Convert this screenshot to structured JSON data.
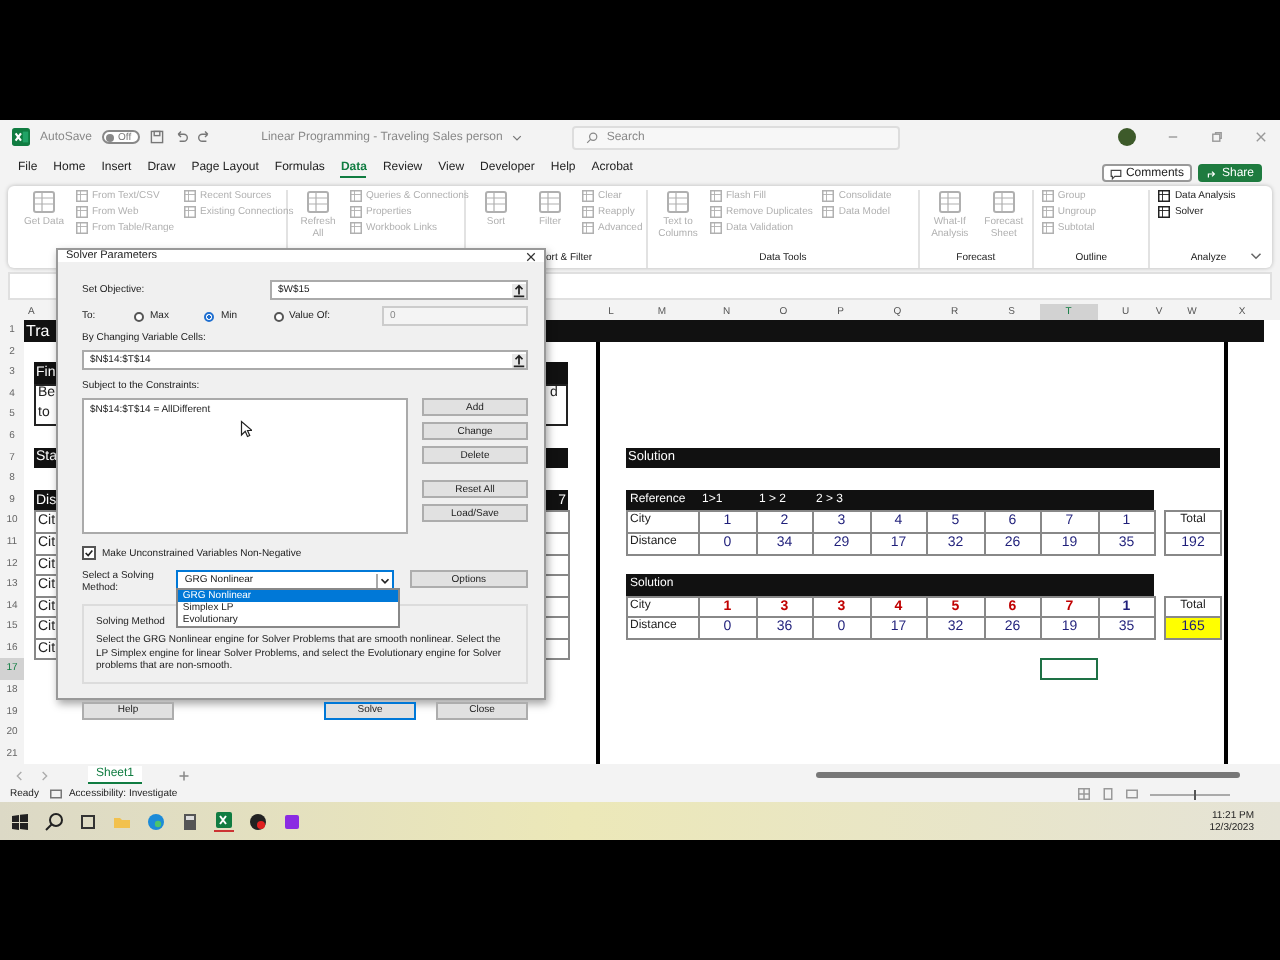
{
  "title_bar": {
    "autosave_label": "AutoSave",
    "autosave_state": "Off",
    "autosave_on": false,
    "document_title": "Linear Programming - Traveling Sales person",
    "search_placeholder": "Search"
  },
  "menu_tabs": [
    {
      "label": "File",
      "selected": false
    },
    {
      "label": "Home",
      "selected": false
    },
    {
      "label": "Insert",
      "selected": false
    },
    {
      "label": "Draw",
      "selected": false
    },
    {
      "label": "Page Layout",
      "selected": false
    },
    {
      "label": "Formulas",
      "selected": false
    },
    {
      "label": "Data",
      "selected": true
    },
    {
      "label": "Review",
      "selected": false
    },
    {
      "label": "View",
      "selected": false
    },
    {
      "label": "Developer",
      "selected": false
    },
    {
      "label": "Help",
      "selected": false
    },
    {
      "label": "Acrobat",
      "selected": false
    }
  ],
  "comments_button": "Comments",
  "share_button": "Share",
  "ribbon": [
    {
      "columns": [
        {
          "kind": "large",
          "items": [
            {
              "label": "Get Data",
              "disabled": true
            }
          ]
        },
        {
          "kind": "small",
          "items": [
            {
              "label": "From Text/CSV",
              "disabled": true
            },
            {
              "label": "From Web",
              "disabled": true
            },
            {
              "label": "From Table/Range",
              "disabled": true
            }
          ]
        },
        {
          "kind": "small",
          "items": [
            {
              "label": "Recent Sources",
              "disabled": true
            },
            {
              "label": "Existing Connections",
              "disabled": true
            }
          ]
        }
      ]
    },
    {
      "columns": [
        {
          "kind": "large",
          "items": [
            {
              "label": "Refresh All",
              "disabled": true
            }
          ]
        },
        {
          "kind": "small",
          "items": [
            {
              "label": "Queries & Connections",
              "disabled": true
            },
            {
              "label": "Properties",
              "disabled": true
            },
            {
              "label": "Workbook Links",
              "disabled": true
            }
          ]
        }
      ]
    },
    {
      "label": "ort & Filter",
      "columns": [
        {
          "kind": "large",
          "items": [
            {
              "label": "Sort",
              "disabled": true
            }
          ]
        },
        {
          "kind": "large",
          "items": [
            {
              "label": "Filter",
              "disabled": true
            }
          ]
        },
        {
          "kind": "small",
          "items": [
            {
              "label": "Clear",
              "disabled": true
            },
            {
              "label": "Reapply",
              "disabled": true
            },
            {
              "label": "Advanced",
              "disabled": true
            }
          ]
        }
      ]
    },
    {
      "label": "Data Tools",
      "columns": [
        {
          "kind": "large",
          "items": [
            {
              "label": "Text to Columns",
              "disabled": true
            }
          ]
        },
        {
          "kind": "small",
          "items": [
            {
              "label": "Flash Fill",
              "disabled": true
            },
            {
              "label": "Remove Duplicates",
              "disabled": true
            },
            {
              "label": "Data Validation",
              "disabled": true
            }
          ]
        },
        {
          "kind": "small",
          "items": [
            {
              "label": "Consolidate",
              "disabled": true
            },
            {
              "label": "Data Model",
              "disabled": true
            }
          ]
        }
      ]
    },
    {
      "label": "Forecast",
      "columns": [
        {
          "kind": "large",
          "items": [
            {
              "label": "What-If Analysis",
              "disabled": true
            }
          ]
        },
        {
          "kind": "large",
          "items": [
            {
              "label": "Forecast Sheet",
              "disabled": true
            }
          ]
        }
      ]
    },
    {
      "label": "Outline",
      "columns": [
        {
          "kind": "small",
          "items": [
            {
              "label": "Group",
              "disabled": true
            },
            {
              "label": "Ungroup",
              "disabled": true
            },
            {
              "label": "Subtotal",
              "disabled": true
            }
          ]
        }
      ]
    },
    {
      "label": "Analyze",
      "columns": [
        {
          "kind": "small",
          "items": [
            {
              "label": "Data Analysis",
              "disabled": false
            },
            {
              "label": "Solver",
              "disabled": false
            }
          ]
        }
      ]
    }
  ],
  "sheet": {
    "column_headers": [
      {
        "label": "A",
        "selected": false
      },
      {
        "label": "L",
        "selected": false
      },
      {
        "label": "M",
        "selected": false
      },
      {
        "label": "N",
        "selected": false
      },
      {
        "label": "O",
        "selected": false
      },
      {
        "label": "P",
        "selected": false
      },
      {
        "label": "Q",
        "selected": false
      },
      {
        "label": "R",
        "selected": false
      },
      {
        "label": "S",
        "selected": false
      },
      {
        "label": "T",
        "selected": true
      },
      {
        "label": "U",
        "selected": false
      },
      {
        "label": "V",
        "selected": false
      },
      {
        "label": "W",
        "selected": false
      },
      {
        "label": "X",
        "selected": false
      }
    ],
    "row_numbers": [
      {
        "label": "1",
        "selected": false
      },
      {
        "label": "2",
        "selected": false
      },
      {
        "label": "3",
        "selected": false
      },
      {
        "label": "4",
        "selected": false
      },
      {
        "label": "5",
        "selected": false
      },
      {
        "label": "6",
        "selected": false
      },
      {
        "label": "7",
        "selected": false
      },
      {
        "label": "8",
        "selected": false
      },
      {
        "label": "9",
        "selected": false
      },
      {
        "label": "10",
        "selected": false
      },
      {
        "label": "11",
        "selected": false
      },
      {
        "label": "12",
        "selected": false
      },
      {
        "label": "13",
        "selected": false
      },
      {
        "label": "14",
        "selected": false
      },
      {
        "label": "15",
        "selected": false
      },
      {
        "label": "16",
        "selected": false
      },
      {
        "label": "17",
        "selected": true
      },
      {
        "label": "18",
        "selected": false
      },
      {
        "label": "19",
        "selected": false
      },
      {
        "label": "20",
        "selected": false
      },
      {
        "label": "21",
        "selected": false
      }
    ],
    "title_cell": "Tra",
    "find_header": "Fin",
    "find_text_lines": [
      "Be",
      "to"
    ],
    "find_text_end": "d",
    "start_header": "Sta",
    "distance_header": "Dis",
    "distance_header_end": "7",
    "city_cells": [
      "Cit",
      "Cit",
      "Cit",
      "Cit",
      "Cit",
      "Cit",
      "Cit"
    ],
    "solution_title": "Solution",
    "reference_table": {
      "headers": [
        "Reference",
        "1>1",
        "1 > 2",
        "2 > 3"
      ],
      "rows": [
        {
          "label": "City",
          "values": [
            "1",
            "2",
            "3",
            "4",
            "5",
            "6",
            "7",
            "1"
          ]
        },
        {
          "label": "Distance",
          "values": [
            "0",
            "34",
            "29",
            "17",
            "32",
            "26",
            "19",
            "35"
          ]
        }
      ],
      "total_label": "Total",
      "total_value": "192",
      "total_highlighted": false
    },
    "solution_table": {
      "headers": [
        "Solution"
      ],
      "rows": [
        {
          "label": "City",
          "values": [
            {
              "text": "1",
              "color": "#c00000"
            },
            {
              "text": "3",
              "color": "#c00000"
            },
            {
              "text": "3",
              "color": "#c00000"
            },
            {
              "text": "4",
              "color": "#c00000"
            },
            {
              "text": "5",
              "color": "#c00000"
            },
            {
              "text": "6",
              "color": "#c00000"
            },
            {
              "text": "7",
              "color": "#c00000"
            },
            {
              "text": "1",
              "color": "#1f1f7a"
            }
          ]
        },
        {
          "label": "Distance",
          "values": [
            "0",
            "36",
            "0",
            "17",
            "32",
            "26",
            "19",
            "35"
          ]
        }
      ],
      "total_label": "Total",
      "total_value": "165",
      "total_highlighted": true
    }
  },
  "dialog": {
    "title": "Solver Parameters",
    "set_objective_label": "Set Objective:",
    "objective_value": "$W$15",
    "to_label": "To:",
    "targets": [
      {
        "label": "Max",
        "selected": false
      },
      {
        "label": "Min",
        "selected": true
      },
      {
        "label": "Value Of:",
        "selected": false
      }
    ],
    "value_of": "0",
    "changing_label": "By Changing Variable Cells:",
    "changing_value": "$N$14:$T$14",
    "constraints_label": "Subject to the Constraints:",
    "constraints": [
      "$N$14:$T$14 = AllDifferent"
    ],
    "constraint_buttons": [
      "Add",
      "Change",
      "Delete",
      "Reset All",
      "Load/Save"
    ],
    "nonnegative": {
      "label": "Make Unconstrained Variables Non-Negative",
      "checked": true
    },
    "method_label": "Select a Solving Method:",
    "method_value": "GRG Nonlinear",
    "method_options": [
      {
        "label": "GRG Nonlinear",
        "selected": true
      },
      {
        "label": "Simplex LP",
        "selected": false
      },
      {
        "label": "Evolutionary",
        "selected": false
      }
    ],
    "options_button": "Options",
    "group_title": "Solving Method",
    "description": "Select the GRG Nonlinear engine for Solver Problems that are smooth nonlinear. Select the LP Simplex engine for linear Solver Problems, and select the Evolutionary engine for Solver problems that are non-smooth.",
    "buttons": [
      {
        "label": "Help",
        "default": false
      },
      {
        "label": "Solve",
        "default": true
      },
      {
        "label": "Close",
        "default": false
      }
    ]
  },
  "sheet_tabs": [
    {
      "label": "Sheet1",
      "selected": true
    }
  ],
  "status_bar": {
    "ready": "Ready",
    "accessibility": "Accessibility: Investigate",
    "zoom_slider": {
      "level": 0.55
    }
  },
  "taskbar": {
    "time": "11:21 PM",
    "date": "12/3/2023"
  }
}
